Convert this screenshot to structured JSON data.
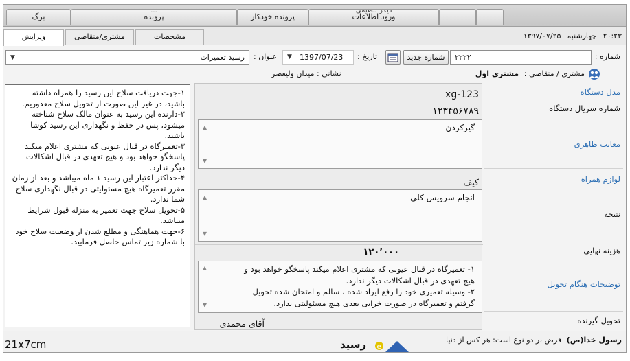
{
  "menubar": {
    "items": [
      {
        "label": "برگ",
        "sub": ""
      },
      {
        "label": "پرونده",
        "sub": "..."
      },
      {
        "label": "پرونده خودکار",
        "sub": ""
      },
      {
        "label": "ورود اطلاعات",
        "sub": "دیگر    تنظیمی"
      },
      {
        "label": "",
        "sub": ""
      },
      {
        "label": "",
        "sub": ""
      }
    ]
  },
  "tabs": {
    "edit": "ویرایش",
    "customer": "مشتری/متقاضی",
    "specs": "مشخصات"
  },
  "clock": {
    "time": "۲۰:۲۳",
    "day": "چهارشنبه",
    "date": "۱۳۹۷/۰۷/۲۵"
  },
  "form": {
    "number_label": "شماره :",
    "number_value": "۲۲۲۲",
    "new_number_button": "شماره جدید",
    "date_label": "تاریخ :",
    "date_value": "1397/07/23",
    "title_label": "عنوان :",
    "title_value": "رسید تعمیرات"
  },
  "customer": {
    "label": "مشتری / متقاضی :",
    "value": "مشتری اول",
    "address_label": "نشانی :",
    "address_value": "میدان ولیعصر"
  },
  "fields": {
    "model_label": "مدل دستگاه",
    "model_value": "xg-123",
    "serial_label": "شماره سریال دستگاه",
    "serial_value": "۱۲۳۴۵۶۷۸۹",
    "defects_label": "معایب ظاهری",
    "defects_value": "گیرکردن",
    "accessories_label": "لوازم همراه",
    "accessories_value": "کیف",
    "result_label": "نتیجه",
    "result_value": "انجام سرویس کلی",
    "cost_label": "هزینه نهایی",
    "cost_value": "۱۲۰٬۰۰۰",
    "delivery_notes_label": "توضیحات هنگام تحویل",
    "delivery_notes_lines": [
      "۱- تعمیرگاه در قبال عیوبی که مشتری اعلام میکند پاسخگو خواهد بود و",
      "هیچ تعهدی در قبال اشکالات دیگر ندارد.",
      "۲- وسیله تعمیری خود را رفع ایراد شده ، سالم و امتحان شده تحویل",
      "گرفتم و تعمیرگاه در صورت خرابی بعدی هیچ مسئولیتی ندارد."
    ],
    "receiver_label": "تحویل گیرنده",
    "receiver_value": "آقای محمدی"
  },
  "terms": [
    "۱-جهت دریافت سلاح این رسید را همراه داشته باشید، در غیر این صورت از تحویل سلاح معذوریم.",
    "۲-دارنده این رسید به عنوان مالک سلاح شناخته میشود، پس در حفظ و نگهداری این رسید کوشا باشید.",
    "۳-تعمیرگاه در قبال عیوبی که مشتری اعلام میکند پاسخگو خواهد بود و هیچ تعهدی در قبال اشکالات دیگر ندارد.",
    "۴-حداکثر اعتبار این رسید ۱ ماه میباشد و بعد از زمان مقرر تعمیرگاه هیچ مسئولیتی در قبال نگهداری سلاح شما ندارد.",
    "۵-تحویل سلاح جهت تعمیر به منزله قبول شرایط میباشد.",
    "۶-جهت هماهنگی و مطلع شدن از وضعیت سلاح خود با شماره زیر تماس حاصل فرمایید."
  ],
  "bottom": {
    "quote_title": "رسول خدا(ص)",
    "quote_text": "قرض بر دو نوع است: هر کس از دنیا",
    "size_label": "21x7cm",
    "print_title": "رسید"
  },
  "colors": {
    "link": "#2d6fb4",
    "panel": "#ececec"
  }
}
